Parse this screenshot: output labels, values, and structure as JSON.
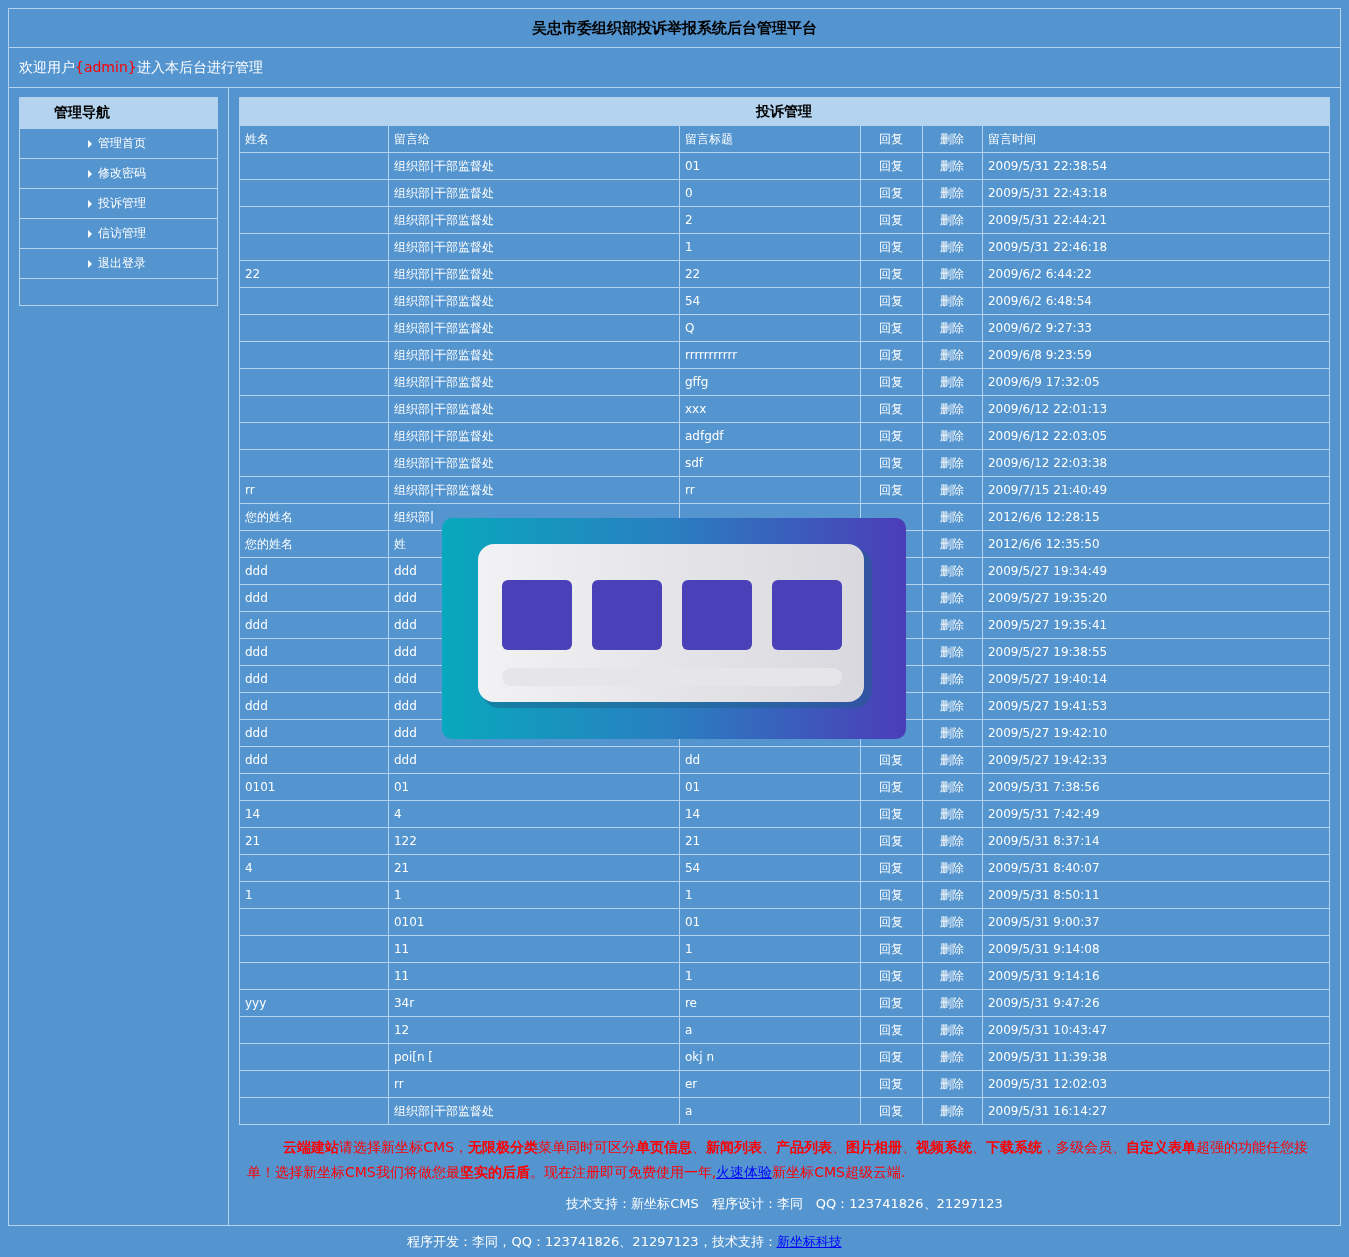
{
  "header": {
    "title": "吴忠市委组织部投诉举报系统后台管理平台"
  },
  "welcome": {
    "before": "欢迎用户",
    "user": "{admin}",
    "after": "进入本后台进行管理"
  },
  "sidebar": {
    "title": "管理导航",
    "items": [
      "管理首页",
      "修改密码",
      "投诉管理",
      "信访管理",
      "退出登录"
    ]
  },
  "table": {
    "title": "投诉管理",
    "columns": [
      "姓名",
      "留言给",
      "留言标题",
      "回复",
      "删除",
      "留言时间"
    ],
    "rows": [
      {
        "to": "组织部|干部监督处",
        "title": "01",
        "reply": "回复",
        "del": "删除",
        "time": "2009/5/31 22:38:54"
      },
      {
        "to": "组织部|干部监督处",
        "title": "0",
        "reply": "回复",
        "del": "删除",
        "time": "2009/5/31 22:43:18"
      },
      {
        "to": "组织部|干部监督处",
        "title": "2",
        "reply": "回复",
        "del": "删除",
        "time": "2009/5/31 22:44:21"
      },
      {
        "to": "组织部|干部监督处",
        "title": "1",
        "reply": "回复",
        "del": "删除",
        "time": "2009/5/31 22:46:18"
      },
      {
        "name": "22",
        "to": "组织部|干部监督处",
        "title": "22",
        "reply": "回复",
        "del": "删除",
        "time": "2009/6/2 6:44:22"
      },
      {
        "to": "组织部|干部监督处",
        "title": "54",
        "reply": "回复",
        "del": "删除",
        "time": "2009/6/2 6:48:54"
      },
      {
        "to": "组织部|干部监督处",
        "title": "Q",
        "reply": "回复",
        "del": "删除",
        "time": "2009/6/2 9:27:33"
      },
      {
        "to": "组织部|干部监督处",
        "title": "rrrrrrrrrrr",
        "reply": "回复",
        "del": "删除",
        "time": "2009/6/8 9:23:59"
      },
      {
        "to": "组织部|干部监督处",
        "title": "gffg",
        "reply": "回复",
        "del": "删除",
        "time": "2009/6/9 17:32:05"
      },
      {
        "to": "组织部|干部监督处",
        "title": "xxx",
        "reply": "回复",
        "del": "删除",
        "time": "2009/6/12 22:01:13"
      },
      {
        "to": "组织部|干部监督处",
        "title": "adfgdf",
        "reply": "回复",
        "del": "删除",
        "time": "2009/6/12 22:03:05"
      },
      {
        "to": "组织部|干部监督处",
        "title": "sdf",
        "reply": "回复",
        "del": "删除",
        "time": "2009/6/12 22:03:38"
      },
      {
        "name": "rr",
        "to": "组织部|干部监督处",
        "title": "rr",
        "reply": "回复",
        "del": "删除",
        "time": "2009/7/15 21:40:49"
      },
      {
        "name": "您的姓名",
        "to": "组织部|",
        "del": "删除",
        "time": "2012/6/6 12:28:15"
      },
      {
        "name": "您的姓名",
        "to": "姓",
        "del": "删除",
        "time": "2012/6/6 12:35:50"
      },
      {
        "name": "ddd",
        "to": "ddd",
        "del": "删除",
        "time": "2009/5/27 19:34:49"
      },
      {
        "name": "ddd",
        "to": "ddd",
        "del": "删除",
        "time": "2009/5/27 19:35:20"
      },
      {
        "name": "ddd",
        "to": "ddd",
        "del": "删除",
        "time": "2009/5/27 19:35:41"
      },
      {
        "name": "ddd",
        "to": "ddd",
        "del": "删除",
        "time": "2009/5/27 19:38:55"
      },
      {
        "name": "ddd",
        "to": "ddd",
        "del": "删除",
        "time": "2009/5/27 19:40:14"
      },
      {
        "name": "ddd",
        "to": "ddd",
        "del": "删除",
        "time": "2009/5/27 19:41:53"
      },
      {
        "name": "ddd",
        "to": "ddd",
        "del": "删除",
        "time": "2009/5/27 19:42:10"
      },
      {
        "name": "ddd",
        "to": "ddd",
        "title": "dd",
        "reply": "回复",
        "del": "删除",
        "time": "2009/5/27 19:42:33"
      },
      {
        "name": "0101",
        "to": "01",
        "title": "01",
        "reply": "回复",
        "del": "删除",
        "time": "2009/5/31 7:38:56"
      },
      {
        "name": "14",
        "to": "4",
        "title": "14",
        "reply": "回复",
        "del": "删除",
        "time": "2009/5/31 7:42:49"
      },
      {
        "name": "21",
        "to": "122",
        "title": "21",
        "reply": "回复",
        "del": "删除",
        "time": "2009/5/31 8:37:14"
      },
      {
        "name": "4",
        "to": "21",
        "title": "54",
        "reply": "回复",
        "del": "删除",
        "time": "2009/5/31 8:40:07"
      },
      {
        "name": "1",
        "to": "1",
        "title": "1",
        "reply": "回复",
        "del": "删除",
        "time": "2009/5/31 8:50:11"
      },
      {
        "to": "0101",
        "title": "01",
        "reply": "回复",
        "del": "删除",
        "time": "2009/5/31 9:00:37"
      },
      {
        "to": "11",
        "title": "1",
        "reply": "回复",
        "del": "删除",
        "time": "2009/5/31 9:14:08"
      },
      {
        "to": "11",
        "title": "1",
        "reply": "回复",
        "del": "删除",
        "time": "2009/5/31 9:14:16"
      },
      {
        "name": "yyy",
        "to": "34r",
        "title": "re",
        "reply": "回复",
        "del": "删除",
        "time": "2009/5/31 9:47:26"
      },
      {
        "to": "12",
        "title": "a",
        "reply": "回复",
        "del": "删除",
        "time": "2009/5/31 10:43:47"
      },
      {
        "to": "poi[n [",
        "title": "okj n",
        "reply": "回复",
        "del": "删除",
        "time": "2009/5/31 11:39:38"
      },
      {
        "to": "rr",
        "title": "er",
        "reply": "回复",
        "del": "删除",
        "time": "2009/5/31 12:02:03"
      },
      {
        "to": "组织部|干部监督处",
        "title": "a",
        "reply": "回复",
        "del": "删除",
        "time": "2009/5/31 16:14:27"
      }
    ]
  },
  "promo": {
    "before": "**云端建站**请选择新坐标CMS，**无限极分类**菜单同时可区分**单页信息**、**新闻列表**、**产品列表**、**图片相册**、**视频系统**、**下载系统**，多级会员、**自定义表单**超强的功能任您接单！选择新坐标CMS我们将做您最**坚实的后盾**。现在注册即可免费使用一年,",
    "link": "火速体验",
    "after": "新坐标CMS超级云端."
  },
  "credits": "技术支持：新坐标CMS　程序设计：李同　QQ：123741826、21297123",
  "footer": {
    "text": "程序开发：李同，QQ：123741826、21297123，技术支持：",
    "link": "新坐标科技"
  }
}
